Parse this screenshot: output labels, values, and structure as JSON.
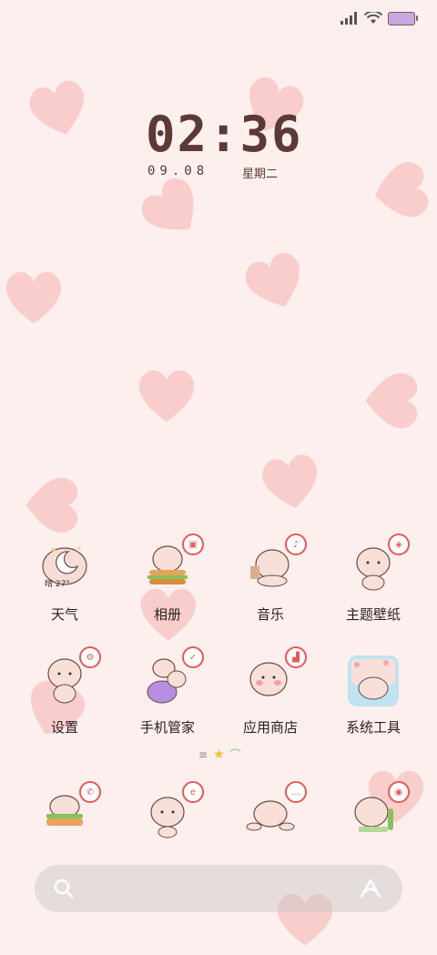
{
  "status_bar": {
    "signal_icon": "signal-icon",
    "wifi_icon": "wifi-icon",
    "battery_icon": "battery-icon"
  },
  "clock": {
    "time": "02:36",
    "date": "09.08",
    "weekday": "星期二"
  },
  "apps_row1": [
    {
      "label": "天气",
      "weather": "晴 27°"
    },
    {
      "label": "相册"
    },
    {
      "label": "音乐"
    },
    {
      "label": "主题壁纸"
    }
  ],
  "apps_row2": [
    {
      "label": "设置"
    },
    {
      "label": "手机管家"
    },
    {
      "label": "应用商店"
    },
    {
      "label": "系统工具"
    }
  ],
  "dock": [
    "phone-app",
    "browser-app",
    "messages-app",
    "camera-app"
  ],
  "colors": {
    "background": "#fdefed",
    "heart": "#f5b7b5",
    "text": "#2d2020"
  }
}
